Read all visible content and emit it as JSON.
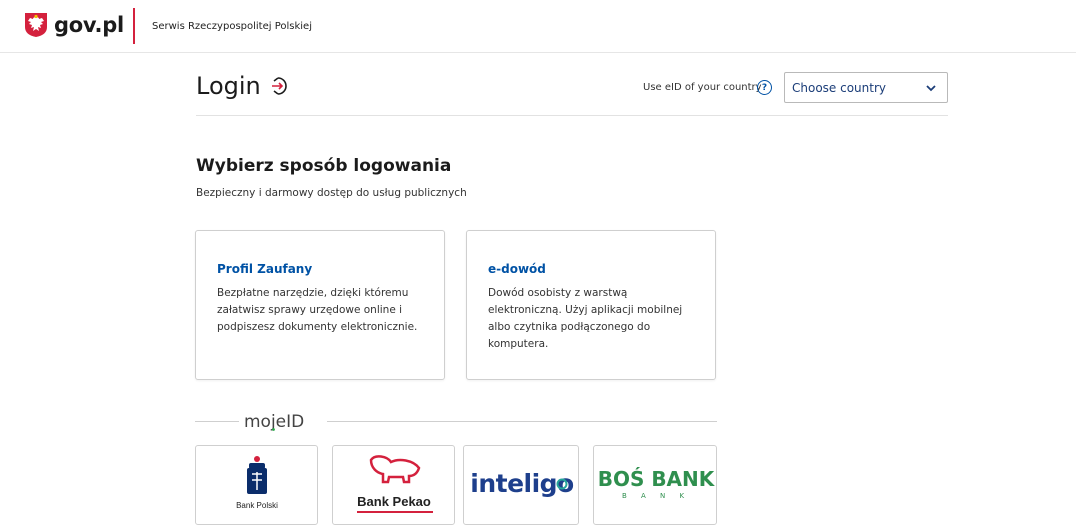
{
  "header": {
    "logo_text": "gov.pl",
    "service_name": "Serwis Rzeczypospolitej Polskiej",
    "accent_color": "#d4213d"
  },
  "login": {
    "title": "Login",
    "eid_label": "Use eID of your country",
    "help_symbol": "?",
    "country_select": {
      "value": "Choose country"
    }
  },
  "section": {
    "title": "Wybierz sposób logowania",
    "subtitle": "Bezpieczny i darmowy dostęp do usług publicznych"
  },
  "cards": [
    {
      "title": "Profil Zaufany",
      "text": "Bezpłatne narzędzie, dzięki któremu załatwisz sprawy urzędowe online i podpiszesz dokumenty elektronicznie."
    },
    {
      "title": "e-dowód",
      "text": "Dowód osobisty z warstwą elektroniczną. Użyj aplikacji mobilnej albo czytnika podłączonego do komputera."
    }
  ],
  "mojeid": {
    "logo_text": "mojeID",
    "banks": [
      {
        "name": "Bank Polski",
        "logo": "pko-bp-logo"
      },
      {
        "name": "Bank Pekao",
        "logo": "pekao-bison-logo"
      },
      {
        "name": "inteligo",
        "logo": "inteligo-logo"
      },
      {
        "name": "BOŚ BANK",
        "logo": "bos-bank-logo"
      }
    ]
  },
  "colors": {
    "link": "#0052a5",
    "text": "#1b1b1b",
    "border": "#cfcfcf"
  }
}
